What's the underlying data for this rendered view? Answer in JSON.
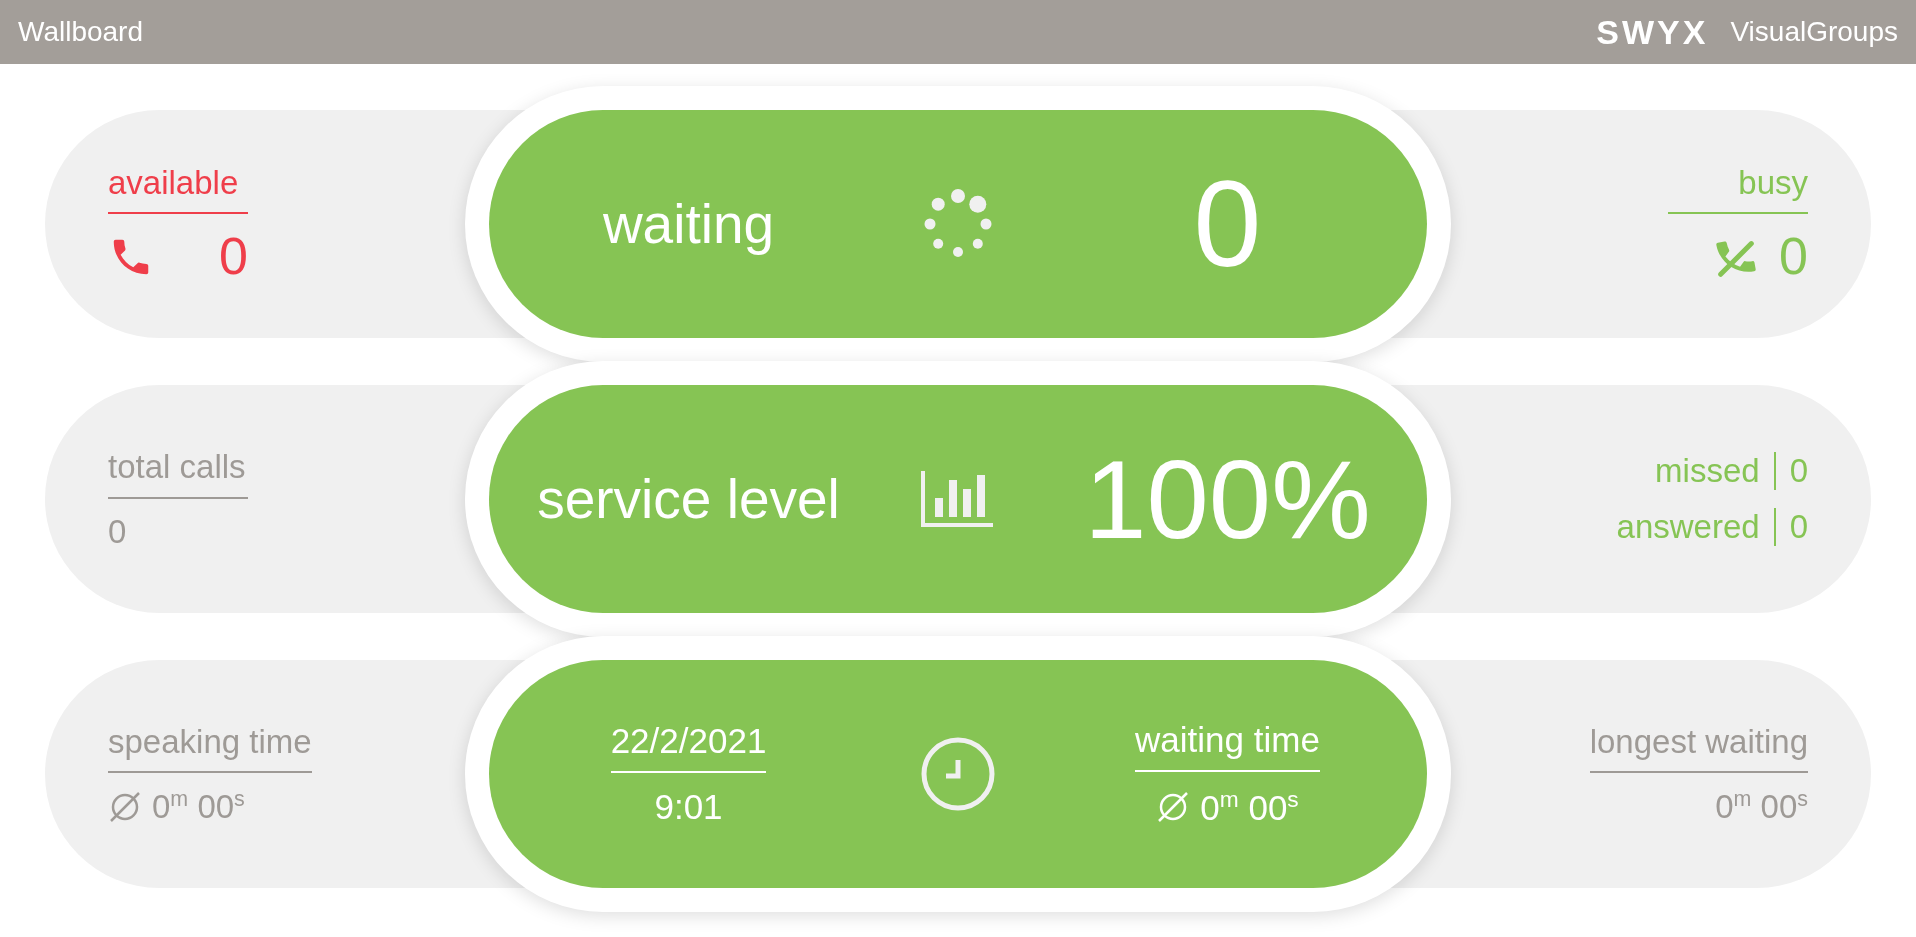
{
  "header": {
    "title": "Wallboard",
    "logo": "SWYX",
    "product": "VisualGroups"
  },
  "available": {
    "label": "available",
    "value": "0",
    "color": "#ef3e4a"
  },
  "waiting": {
    "label": "waiting",
    "value": "0"
  },
  "busy": {
    "label": "busy",
    "value": "0",
    "color": "#86c454"
  },
  "total_calls": {
    "label": "total calls",
    "value": "0"
  },
  "service_level": {
    "label": "service level",
    "value": "100%"
  },
  "call_results": [
    {
      "label": "missed",
      "value": "0"
    },
    {
      "label": "answered",
      "value": "0"
    }
  ],
  "speaking_time": {
    "label": "speaking time",
    "value": "0$^{m}$ 00$^{s}$"
  },
  "clock": {
    "date": "22/2/2021",
    "time": "9:01"
  },
  "waiting_time": {
    "label": "waiting time",
    "value": "0$^{m}$ 00$^{s}$"
  },
  "longest_waiting": {
    "label": "longest waiting",
    "value": "0$^{m}$ 00$^{s}$"
  }
}
